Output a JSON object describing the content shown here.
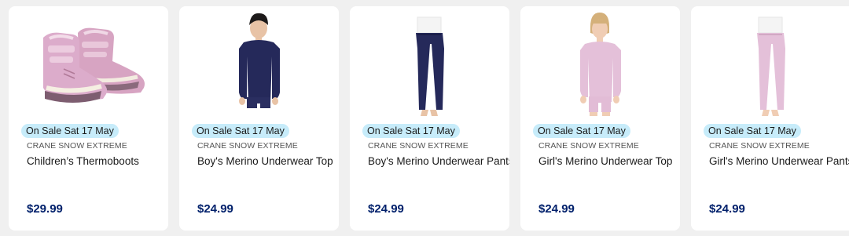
{
  "products": [
    {
      "badge": "On Sale Sat 17 May",
      "brand": "CRANE SNOW EXTREME",
      "name": "Children’s Thermoboots",
      "price": "$29.99",
      "image": "pink-kids-thermoboots"
    },
    {
      "badge": "On Sale Sat 17 May",
      "brand": "CRANE SNOW EXTREME",
      "name": "Boy's Merino Underwear Top",
      "price": "$24.99",
      "image": "boy-navy-thermal-top"
    },
    {
      "badge": "On Sale Sat 17 May",
      "brand": "CRANE SNOW EXTREME",
      "name": "Boy's Merino Underwear Pants",
      "price": "$24.99",
      "image": "navy-thermal-pants"
    },
    {
      "badge": "On Sale Sat 17 May",
      "brand": "CRANE SNOW EXTREME",
      "name": "Girl's Merino Underwear Top",
      "price": "$24.99",
      "image": "girl-pink-thermal-top"
    },
    {
      "badge": "On Sale Sat 17 May",
      "brand": "CRANE SNOW EXTREME",
      "name": "Girl's Merino Underwear Pants",
      "price": "$24.99",
      "image": "pink-thermal-pants"
    }
  ],
  "colors": {
    "price": "#00206b",
    "badge_bg": "#c7ecfa",
    "navy_garment": "#25295a",
    "pink_garment": "#e4c0d9",
    "pink_boot": "#d9a8c4"
  }
}
